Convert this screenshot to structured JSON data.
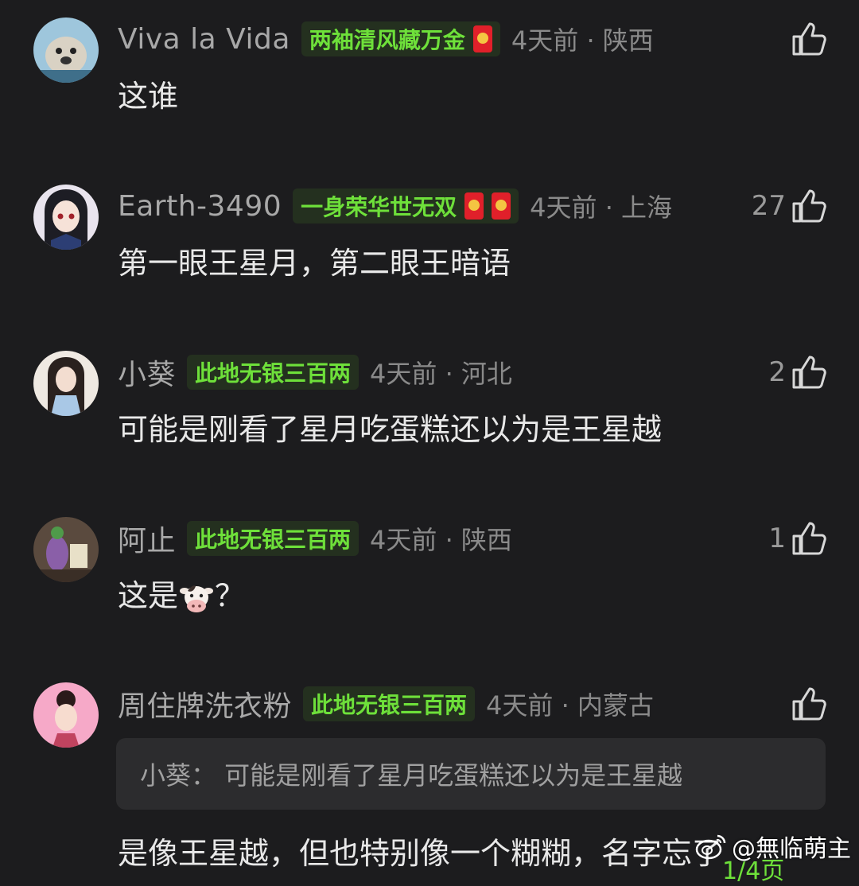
{
  "comments": [
    {
      "username": "Viva la Vida",
      "badge": "两袖清风藏万金",
      "meta": "4天前 · 陕西",
      "likes": "",
      "text": "这谁"
    },
    {
      "username": "Earth-3490",
      "badge": "一身荣华世无双",
      "meta": "4天前 · 上海",
      "likes": "27",
      "text": "第一眼王星月，第二眼王暗语"
    },
    {
      "username": "小葵",
      "badge": "此地无银三百两",
      "meta": "4天前 · 河北",
      "likes": "2",
      "text": "可能是刚看了星月吃蛋糕还以为是王星越"
    },
    {
      "username": "阿止",
      "badge": "此地无银三百两",
      "meta": "4天前 · 陕西",
      "likes": "1",
      "text_before": "这是",
      "text_after": "？"
    },
    {
      "username": "周住牌洗衣粉",
      "badge": "此地无银三百两",
      "meta": "4天前 · 内蒙古",
      "likes": "",
      "quote": "小葵：  可能是刚看了星月吃蛋糕还以为是王星越",
      "text": "是像王星越，但也特别像一个糊糊，名字忘了"
    }
  ],
  "watermark": {
    "text": "@無临萌主"
  },
  "pager": {
    "text": "1/4页"
  },
  "colors": {
    "background": "#1c1c1e",
    "badge_text": "#6ee03a",
    "badge_bg": "#24301f",
    "meta": "#8a8a8a"
  }
}
